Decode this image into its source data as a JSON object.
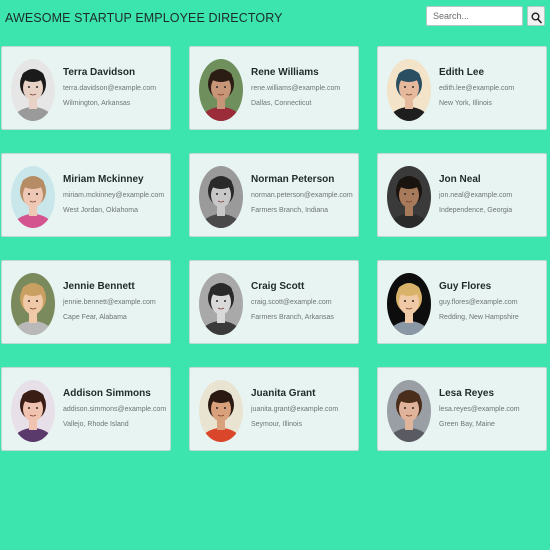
{
  "header": {
    "title": "AWESOME STARTUP EMPLOYEE DIRECTORY",
    "search_placeholder": "Search...",
    "search_icon": "search-icon"
  },
  "employees": [
    {
      "name": "Terra Davidson",
      "email": "terra.davidson@example.com",
      "location": "Wilmington, Arkansas",
      "photo": {
        "bg": "#e6e6e6",
        "skin": "#e8d2c6",
        "hair": "#1a1a1a",
        "shirt": "#9a9a9a"
      }
    },
    {
      "name": "Rene Williams",
      "email": "rene.williams@example.com",
      "location": "Dallas, Connecticut",
      "photo": {
        "bg": "#6f8f5d",
        "skin": "#c79577",
        "hair": "#2b1c14",
        "shirt": "#9b2c3a"
      }
    },
    {
      "name": "Edith Lee",
      "email": "edith.lee@example.com",
      "location": "New York, Illinois",
      "photo": {
        "bg": "#f2e3c9",
        "skin": "#e6b89c",
        "hair": "#2a4f63",
        "shirt": "#1e1e1e"
      }
    },
    {
      "name": "Miriam Mckinney",
      "email": "miriam.mckinney@example.com",
      "location": "West Jordan, Oklahoma",
      "photo": {
        "bg": "#c9e7ea",
        "skin": "#efc8b5",
        "hair": "#b58c63",
        "shirt": "#d4548f"
      }
    },
    {
      "name": "Norman Peterson",
      "email": "norman.peterson@example.com",
      "location": "Farmers Branch, Indiana",
      "photo": {
        "bg": "#9a9a9a",
        "skin": "#c8c8c8",
        "hair": "#2a2a2a",
        "shirt": "#4a4a4a"
      }
    },
    {
      "name": "Jon Neal",
      "email": "jon.neal@example.com",
      "location": "Independence, Georgia",
      "photo": {
        "bg": "#3a3a3a",
        "skin": "#a87a5c",
        "hair": "#1a1410",
        "shirt": "#2a2a2a"
      }
    },
    {
      "name": "Jennie Bennett",
      "email": "jennie.bennett@example.com",
      "location": "Cape Fear, Alabama",
      "photo": {
        "bg": "#7a8a5c",
        "skin": "#efc9a8",
        "hair": "#c9a062",
        "shirt": "#b9b9b9"
      }
    },
    {
      "name": "Craig Scott",
      "email": "craig.scott@example.com",
      "location": "Farmers Branch, Arkansas",
      "photo": {
        "bg": "#a9a9a9",
        "skin": "#d9d9d9",
        "hair": "#2a2a2a",
        "shirt": "#3a3a3a"
      }
    },
    {
      "name": "Guy Flores",
      "email": "guy.flores@example.com",
      "location": "Redding, New Hampshire",
      "photo": {
        "bg": "#0d0d0d",
        "skin": "#f0c9a6",
        "hair": "#d9b36a",
        "shirt": "#8a98a6"
      }
    },
    {
      "name": "Addison Simmons",
      "email": "addison.simmons@example.com",
      "location": "Vallejo, Rhode Island",
      "photo": {
        "bg": "#e8e0e8",
        "skin": "#efc3b0",
        "hair": "#3a1e16",
        "shirt": "#5a3a6a"
      }
    },
    {
      "name": "Juanita Grant",
      "email": "juanita.grant@example.com",
      "location": "Seymour, Illinois",
      "photo": {
        "bg": "#e9e4d2",
        "skin": "#d9a07c",
        "hair": "#2a1a12",
        "shirt": "#d9462a"
      }
    },
    {
      "name": "Lesa Reyes",
      "email": "lesa.reyes@example.com",
      "location": "Green Bay, Maine",
      "photo": {
        "bg": "#9a9fa6",
        "skin": "#e0b49a",
        "hair": "#4a2e1c",
        "shirt": "#5a5a62"
      }
    }
  ]
}
